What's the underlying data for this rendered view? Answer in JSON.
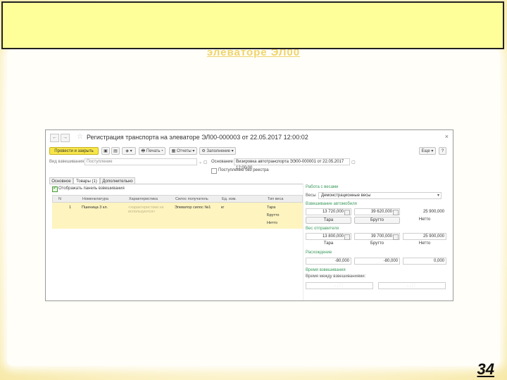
{
  "slide": {
    "page_number": "34",
    "title_shadow": "элеваторе ЭЛ00"
  },
  "window": {
    "title": "Регистрация транспорта на элеваторе ЭЛ00-000003 от 22.05.2017 12:00:02",
    "nav_back": "←",
    "nav_forward": "→",
    "close": "×"
  },
  "toolbar": {
    "post_close": "Провести и закрыть",
    "print": "Печать",
    "reports": "Отчеты",
    "fill": "Заполнение",
    "more": "Еще"
  },
  "header": {
    "weighing_type_label": "Вид взвешивания",
    "weighing_type_value": "Поступление",
    "basis_label": "Основание",
    "basis_value": "Визировка автотранспорта ЭЭ00-000001 от 22.05.2017 12:00:00",
    "no_register_label": "Поступление без реестра"
  },
  "tabs": [
    "Основное",
    "Товары (1)",
    "Дополнительно"
  ],
  "show_panel_label": "Отображать панель взвешивания",
  "grid": {
    "columns": [
      "N",
      "Номенклатура",
      "Характеристика",
      "Силос получатель",
      "Ед. изм.",
      "Тип веса"
    ],
    "row": {
      "n": "1",
      "nomenclature": "Пшеница 3 кл.",
      "characteristic": "<характеристики не используются>",
      "silo": "Элеватор силос №1",
      "unit": "кг",
      "weight_types": [
        "Тара",
        "Брутто",
        "Нетто"
      ]
    }
  },
  "right_panel": {
    "scales_section": "Работа с весами",
    "scales_label": "Весы",
    "scales_value": "Демонстрационные весы",
    "vehicle_section": "Взвешивание автомобиля",
    "vehicle_values": [
      "13 720,000",
      "39 620,000",
      "25 900,000"
    ],
    "tare_btn": "Тара",
    "gross_btn": "Брутто",
    "net_label": "Нетто",
    "sender_section": "Вес отправителя",
    "sender_values": [
      "13 800,000",
      "39 700,000",
      "25 900,000"
    ],
    "sender_labels": [
      "Тара",
      "Брутто",
      "Нетто"
    ],
    "diff_section": "Расхождение",
    "diff_values": [
      "-80,000",
      "-80,000",
      "0,000"
    ],
    "time_section": "Время взвешивания",
    "time_between_label": "Время между взвешиваниями:",
    "time_placeholder": ". . :  :"
  }
}
